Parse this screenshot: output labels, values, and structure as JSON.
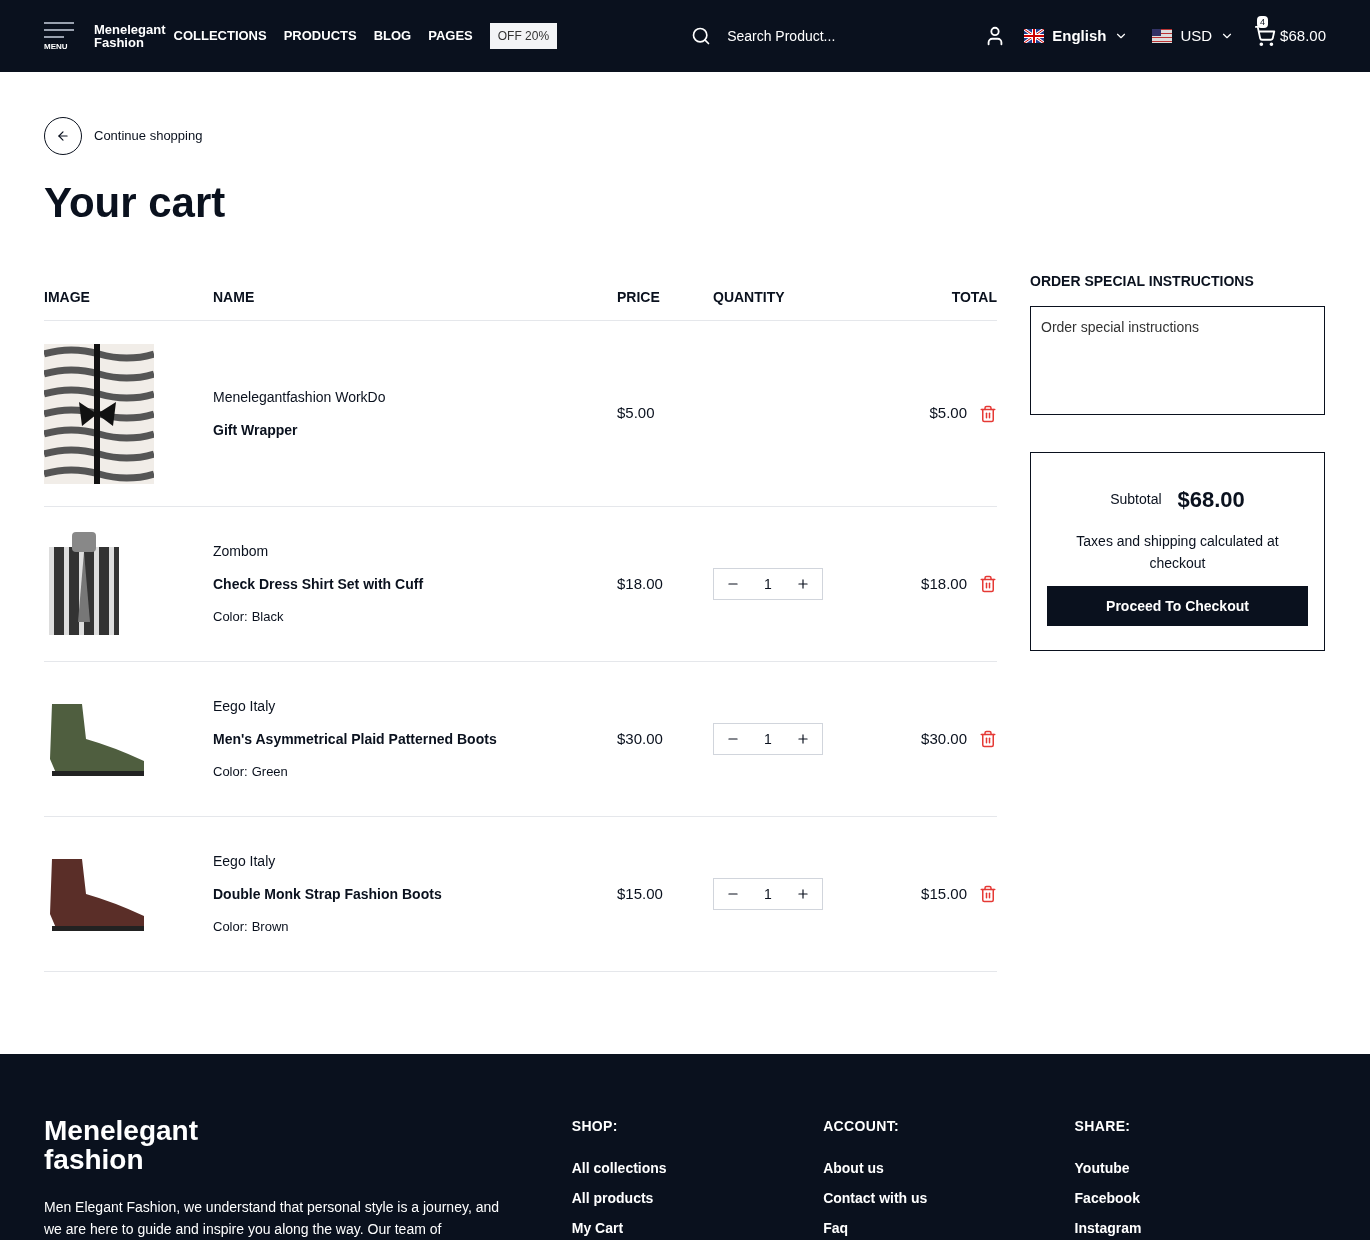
{
  "header": {
    "menu_label": "MENU",
    "brand": [
      "Menelegant",
      "Fashion"
    ],
    "nav": [
      "COLLECTIONS",
      "PRODUCTS",
      "BLOG",
      "PAGES"
    ],
    "promo": "OFF 20%",
    "search": {
      "placeholder": "Search Product..."
    },
    "language": "English",
    "currency": "USD",
    "cart_count": "4",
    "cart_total": "$68.00"
  },
  "back_link": "Continue shopping",
  "title": "Your cart",
  "table": {
    "columns": [
      "IMAGE",
      "NAME",
      "PRICE",
      "QUANTITY",
      "TOTAL"
    ],
    "rows": [
      {
        "kind": "gift",
        "vendor": "Menelegantfashion WorkDo",
        "name": "Gift Wrapper",
        "price": "$5.00",
        "total": "$5.00"
      },
      {
        "kind": "product",
        "vendor": "Zombom",
        "name": "Check Dress Shirt Set with Cuff",
        "option_label": "Color:",
        "option_value": "Black",
        "price": "$18.00",
        "quantity": "1",
        "total": "$18.00"
      },
      {
        "kind": "product",
        "vendor": "Eego Italy",
        "name": "Men's Asymmetrical Plaid Patterned Boots",
        "option_label": "Color:",
        "option_value": "Green",
        "price": "$30.00",
        "quantity": "1",
        "total": "$30.00"
      },
      {
        "kind": "product",
        "vendor": "Eego Italy",
        "name": "Double Monk Strap Fashion Boots",
        "option_label": "Color:",
        "option_value": "Brown",
        "price": "$15.00",
        "quantity": "1",
        "total": "$15.00"
      }
    ]
  },
  "instructions": {
    "heading": "ORDER SPECIAL INSTRUCTIONS",
    "placeholder": "Order special instructions"
  },
  "summary": {
    "subtotal_label": "Subtotal",
    "subtotal": "$68.00",
    "note": "Taxes and shipping calculated at checkout",
    "button": "Proceed To Checkout"
  },
  "footer": {
    "brand": [
      "Menelegant",
      "fashion"
    ],
    "about": "Men Elegant Fashion, we understand that personal style is a journey, and we are here to guide and inspire you along the way. Our team of",
    "columns": [
      {
        "heading": "SHOP:",
        "links": [
          "All collections",
          "All products",
          "My Cart"
        ]
      },
      {
        "heading": "ACCOUNT:",
        "links": [
          "About us",
          "Contact with us",
          "Faq"
        ]
      },
      {
        "heading": "SHARE:",
        "links": [
          "Youtube",
          "Facebook",
          "Instagram"
        ]
      }
    ]
  }
}
